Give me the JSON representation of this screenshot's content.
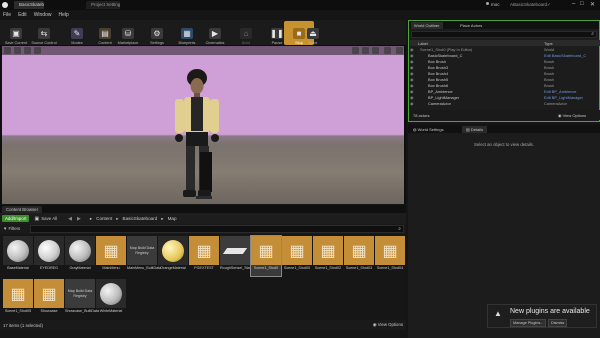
{
  "titlebar": {
    "tabs": [
      "BasicSkatebo...",
      "Project Settings"
    ],
    "right_text": [
      "moc",
      "ABasicSkateboard✓"
    ]
  },
  "menu": [
    "File",
    "Edit",
    "Window",
    "Help"
  ],
  "toolbar": {
    "buttons": [
      {
        "label": "Save Current",
        "icon": "save-icon"
      },
      {
        "label": "Source Control",
        "icon": "source-control-icon"
      },
      {
        "label": "Modes",
        "icon": "modes-icon"
      },
      {
        "label": "Content",
        "icon": "content-icon"
      },
      {
        "label": "Marketplace",
        "icon": "marketplace-icon"
      },
      {
        "label": "Settings",
        "icon": "settings-icon"
      },
      {
        "label": "Blueprints",
        "icon": "blueprints-icon"
      },
      {
        "label": "Cinematics",
        "icon": "cinematics-icon"
      },
      {
        "label": "Build",
        "icon": "build-icon"
      },
      {
        "label": "Pause",
        "icon": "pause-icon"
      },
      {
        "label": "Stop",
        "icon": "stop-icon"
      },
      {
        "label": "Eject",
        "icon": "eject-icon"
      }
    ]
  },
  "content_browser": {
    "tab": "Content Browser",
    "add_new": "Add/Import",
    "save_all": "Save All",
    "breadcrumb": [
      "Content",
      "BasicSkateboard",
      "Map"
    ],
    "filters": "Filters",
    "assets": [
      {
        "label": "BaseMaterial",
        "kind": "sphere"
      },
      {
        "label": "EYEDREG",
        "kind": "sphere"
      },
      {
        "label": "GrayMaterial",
        "kind": "sphere"
      },
      {
        "label": "MainMenu",
        "kind": "map"
      },
      {
        "label": "MainMenu_BuiltData",
        "kind": "data",
        "thumb": "Map Build Data Registry"
      },
      {
        "label": "OrangeMaterial",
        "kind": "sphere-orange"
      },
      {
        "label": "PGEXTEST",
        "kind": "map"
      },
      {
        "label": "RoughSensei_StaticMesh",
        "kind": "mesh"
      },
      {
        "label": "Scene1_Shot0",
        "kind": "map"
      },
      {
        "label": "Scene1_Shot00",
        "kind": "map"
      },
      {
        "label": "Scene1_Shot02",
        "kind": "map"
      },
      {
        "label": "Scene1_Shot03",
        "kind": "map"
      },
      {
        "label": "Scene1_Shot04",
        "kind": "map"
      },
      {
        "label": "Scene1_Shot05",
        "kind": "map"
      },
      {
        "label": "Showcase",
        "kind": "map"
      },
      {
        "label": "Showcase_BuiltData",
        "kind": "data",
        "thumb": "Map Build Data Registry"
      },
      {
        "label": "WhiteMaterial",
        "kind": "sphere"
      }
    ],
    "status": "17 items (1 selected)",
    "view_options": "View Options"
  },
  "outliner": {
    "tab_world_outliner": "World Outliner",
    "tab_place_actors": "Place Actors",
    "col_label": "Label",
    "col_type": "Type",
    "rows": [
      {
        "label": "Scene1_Shot0 (Play In Editor)",
        "type": "World",
        "link": false
      },
      {
        "label": "BasicSkateboard_C",
        "type": "Edit BasicSkateboard_C",
        "link": true
      },
      {
        "label": "Box Brush",
        "type": "Brush",
        "link": false
      },
      {
        "label": "Box Brush3",
        "type": "Brush",
        "link": false
      },
      {
        "label": "Box Brush4",
        "type": "Brush",
        "link": false
      },
      {
        "label": "Box Brush5",
        "type": "Brush",
        "link": false
      },
      {
        "label": "Box Brush6",
        "type": "Brush",
        "link": false
      },
      {
        "label": "BP_Ambience",
        "type": "Edit BP_Ambience",
        "link": true
      },
      {
        "label": "BP_LightManager",
        "type": "Edit BP_LightManager",
        "link": true
      },
      {
        "label": "CameraActor",
        "type": "CameraActor",
        "link": false
      }
    ],
    "actors_count": "78 actors",
    "view_options": "View Options"
  },
  "details": {
    "tab_world_settings": "World Settings",
    "tab_details": "Details",
    "empty_message": "Select an object to view details."
  },
  "notification": {
    "title": "New plugins are available",
    "manage": "Manage Plugins...",
    "dismiss": "Dismiss"
  }
}
